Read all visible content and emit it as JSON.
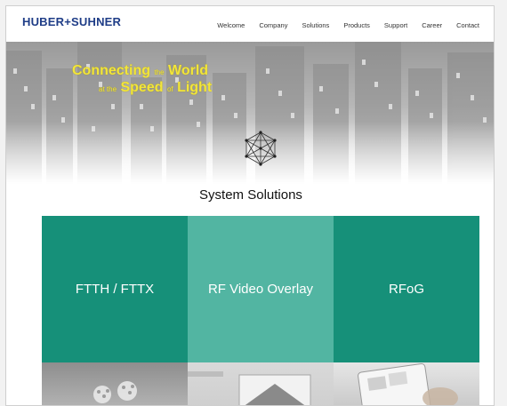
{
  "brand": {
    "logo_text": "HUBER+SUHNER"
  },
  "nav": [
    "Welcome",
    "Company",
    "Solutions",
    "Products",
    "Support",
    "Career",
    "Contact"
  ],
  "hero": {
    "line1": {
      "big1": "Connecting",
      "small": "the",
      "big2": "World"
    },
    "line2": {
      "small1": "at the",
      "big1": "Speed",
      "small2": "of",
      "big2": "Light"
    },
    "accent_color": "#f2e53a"
  },
  "icons": {
    "solutions": "network-icon"
  },
  "section_title": "System Solutions",
  "tiles": [
    {
      "label": "FTTH / FTTX",
      "color": "#169079"
    },
    {
      "label": "RF Video Overlay",
      "color": "#52b5a2"
    },
    {
      "label": "RFoG",
      "color": "#169079"
    }
  ]
}
